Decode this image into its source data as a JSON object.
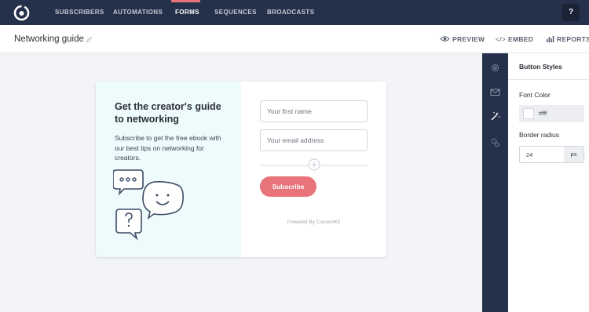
{
  "nav": {
    "items": [
      {
        "label": "SUBSCRIBERS"
      },
      {
        "label": "AUTOMATIONS"
      },
      {
        "label": "FORMS"
      },
      {
        "label": "SEQUENCES"
      },
      {
        "label": "BROADCASTS"
      }
    ],
    "active": "FORMS",
    "help_label": "?"
  },
  "header": {
    "title": "Networking guide",
    "actions": {
      "preview": "PREVIEW",
      "embed": "EMBED",
      "reports": "REPORTS"
    }
  },
  "form": {
    "heading": "Get the creator's guide to networking",
    "description": "Subscribe to get the free ebook with our best tips on networking for creators.",
    "first_name_placeholder": "Your first name",
    "email_placeholder": "Your email address",
    "button_label": "Subscribe",
    "powered_by": "Powered By ConvertKit"
  },
  "rail": {
    "icons": [
      "gear-icon",
      "envelope-icon",
      "magic-wand-icon",
      "gears-icon"
    ]
  },
  "panel": {
    "title": "Button Styles",
    "font_color_label": "Font Color",
    "font_color_value": "#fff",
    "border_radius_label": "Border radius",
    "border_radius_value": "24",
    "border_radius_unit": "px"
  },
  "colors": {
    "nav_bg": "#25304a",
    "accent": "#e8737a",
    "card_left_bg": "#eefbfc",
    "page_bg": "#f3f4f7"
  }
}
